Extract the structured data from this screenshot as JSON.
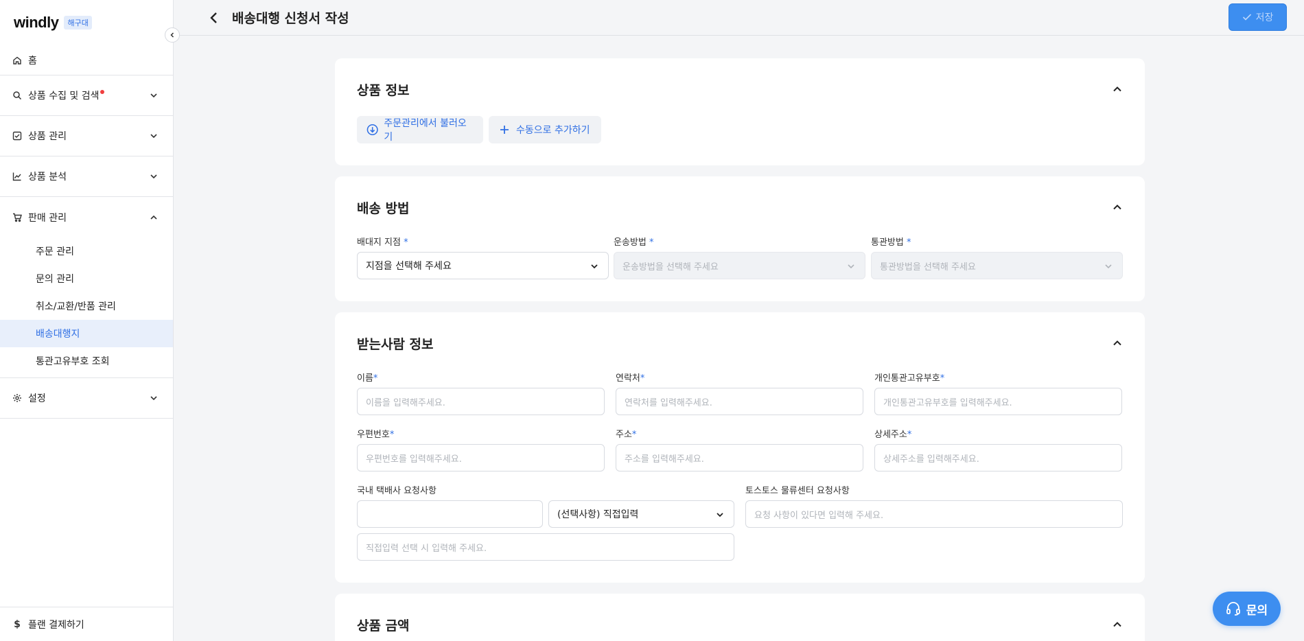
{
  "brand": {
    "logo": "windly",
    "badge": "해구대"
  },
  "nav": {
    "home": "홈",
    "groups": [
      {
        "label": "상품 수집 및 검색",
        "icon": "search-icon",
        "has_alert": true
      },
      {
        "label": "상품 관리",
        "icon": "checkbox-icon"
      },
      {
        "label": "상품 분석",
        "icon": "chart-line-icon"
      },
      {
        "label": "판매 관리",
        "icon": "cart-icon",
        "open": true
      }
    ],
    "sales_items": [
      "주문 관리",
      "문의 관리",
      "취소/교환/반품 관리",
      "배송대행지",
      "통관고유부호 조회"
    ],
    "active_item": "배송대행지",
    "settings": "설정",
    "footer": "플랜 결제하기"
  },
  "header": {
    "title": "배송대행 신청서 작성",
    "save_label": "저장"
  },
  "sections": {
    "product_info": {
      "title": "상품 정보",
      "load_button": "주문관리에서 불러오기",
      "manual_button": "수동으로 추가하기"
    },
    "shipping_method": {
      "title": "배송 방법",
      "branch_label": "배대지 지점",
      "branch_value": "지점을 선택해 주세요",
      "transport_label": "운송방법",
      "transport_placeholder": "운송방법을 선택해 주세요",
      "customs_label": "통관방법",
      "customs_placeholder": "통관방법을 선택해 주세요",
      "required_mark": "*"
    },
    "recipient": {
      "title": "받는사람 정보",
      "name_label": "이름",
      "name_placeholder": "이름을 입력해주세요.",
      "phone_label": "연락처",
      "phone_placeholder": "연락처를 입력해주세요.",
      "customs_code_label": "개인통관고유부호",
      "customs_code_placeholder": "개인통관고유부호를 입력해주세요.",
      "zip_label": "우편번호",
      "zip_placeholder": "우편번호를 입력해주세요.",
      "address_label": "주소",
      "address_placeholder": "주소를 입력해주세요.",
      "detail_label": "상세주소",
      "detail_placeholder": "상세주소를 입력해주세요.",
      "courier_label": "국내 택배사 요청사항",
      "courier_select": "(선택사항) 직접입력",
      "courier_direct_placeholder": "직접입력 선택 시 입력해 주세요.",
      "logistics_label": "토스토스 물류센터 요청사항",
      "logistics_placeholder": "요청 사항이 있다면 입력해 주세요.",
      "required_mark": "*"
    },
    "product_amount": {
      "title": "상품 금액"
    }
  },
  "chat": {
    "label": "문의"
  },
  "colors": {
    "accent": "#3d8ef0",
    "link": "#2f6fe4",
    "active_bg": "#e8effb",
    "alert": "#f03e3e"
  }
}
